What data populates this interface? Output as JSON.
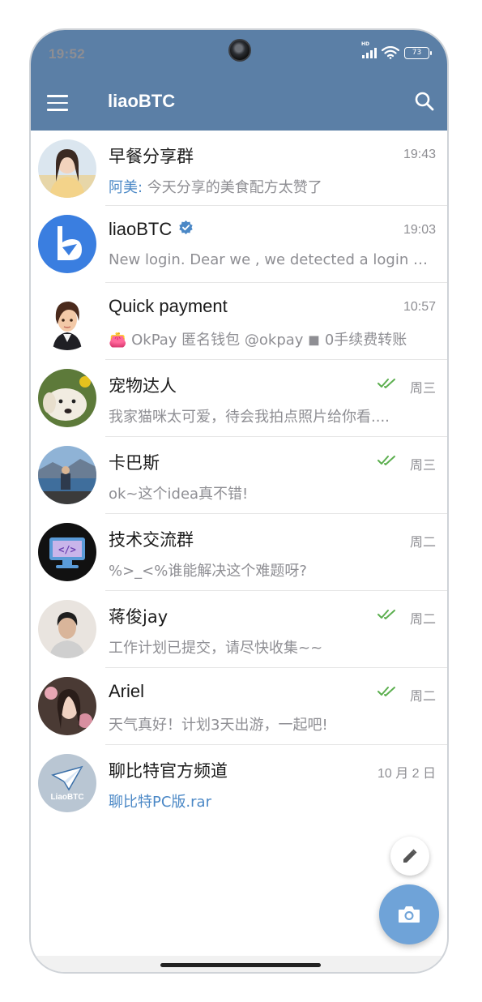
{
  "status": {
    "time": "19:52",
    "battery": "73",
    "network": "HD"
  },
  "appbar": {
    "title": "liaoBTC"
  },
  "colors": {
    "header": "#5b7fa6",
    "accent": "#4b88c6",
    "fab": "#6fa3d8",
    "read_ticks": "#5caf4f"
  },
  "chats": [
    {
      "name": "早餐分享群",
      "time": "19:43",
      "sender": "阿美",
      "message": "今天分享的美食配方太赞了"
    },
    {
      "name": "liaoBTC",
      "time": "19:03",
      "message": "New login. Dear  we , we detected a login into your account from a new device",
      "verified": true
    },
    {
      "name": "Quick payment",
      "time": "10:57",
      "message": "👛 OkPay 匿名钱包  @okpay  ◼ 0手续费转账"
    },
    {
      "name": "宠物达人",
      "time": "周三",
      "message": "我家猫咪太可爱，待会我拍点照片给你看....",
      "read": true
    },
    {
      "name": "卡巴斯",
      "time": "周三",
      "message": "ok~这个idea真不错!",
      "read": true
    },
    {
      "name": "技术交流群",
      "time": "周二",
      "message": "%>_<%谁能解决这个难题呀?"
    },
    {
      "name": "蒋俊jay",
      "time": "周二",
      "message": "工作计划已提交，请尽快收集~~",
      "read": true
    },
    {
      "name": "Ariel",
      "time": "周二",
      "message": "天气真好！计划3天出游，一起吧!",
      "read": true
    },
    {
      "name": "聊比特官方频道",
      "time": "10 月 2 日",
      "message": "聊比特PC版.rar",
      "avatar_text": "LiaoBTC"
    }
  ],
  "icons": {
    "menu": "hamburger-menu-icon",
    "search": "search-icon",
    "compose": "pencil-icon",
    "camera": "camera-icon",
    "verified": "verified-badge-icon",
    "read": "double-check-icon"
  }
}
